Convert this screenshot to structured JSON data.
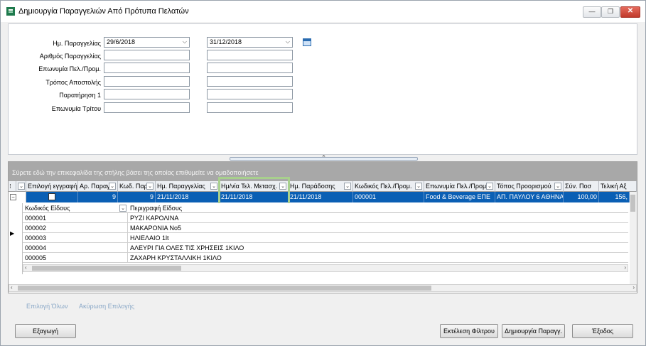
{
  "window": {
    "title": "Δημιουργία Παραγγελιών Από Πρότυπα Πελατών",
    "min_glyph": "—",
    "max_glyph": "❐",
    "close_glyph": "✕"
  },
  "filters": {
    "order_date_label": "Ημ. Παραγγελίας",
    "order_date_from": "29/6/2018",
    "order_date_to": "31/12/2018",
    "order_no_label": "Αριθμός Παραγγελίας",
    "customer_label": "Επωνυμία Πελ./Προμ.",
    "shipping_label": "Τρόπος Αποστολής",
    "note1_label": "Παρατήρηση 1",
    "third_party_label": "Επωνυμία Τρίτου"
  },
  "grid": {
    "group_hint": "Σύρετε εδώ την επικεφαλίδα της στήλης βάσει της οποίας επιθυμείτε να ομαδοποιήσετε",
    "columns": [
      "Επιλογή εγγραφής",
      "Αρ. Παραγ",
      "Κωδ. Παρ",
      "Ημ. Παραγγελίας",
      "Ημ/νία Τελ. Μετασχ.",
      "Ημ. Παράδοσης",
      "Κωδικός Πελ./Προμ.",
      "Επωνυμία Πελ./Προμ.",
      "Τόπος Προορισμού",
      "Σύν. Ποσ",
      "Τελική Αξ"
    ],
    "selected_row": {
      "order_no": "9",
      "code": "9",
      "order_date": "21/11/2018",
      "final_transform_date": "21/11/2018",
      "delivery_date": "21/11/2018",
      "customer_code": "000001",
      "customer_name": "Food & Beverage ΕΠΕ",
      "destination": "ΑΠ. ΠΑΥΛΟΥ 6 ΑΘΗΝΑ",
      "total_qty": "100,00",
      "final_value": "156,"
    },
    "child": {
      "col_code": "Κωδικός Είδους",
      "col_desc": "Περιγραφή Είδους",
      "rows": [
        {
          "code": "000001",
          "desc": "ΡΥΖΙ ΚΑΡΟΛΙΝΑ"
        },
        {
          "code": "000002",
          "desc": "ΜΑΚΑΡΟΝΙΑ No5"
        },
        {
          "code": "000003",
          "desc": "ΗΛΙΕΛΑΙΟ 1lt"
        },
        {
          "code": "000004",
          "desc": "ΑΛΕΥΡΙ ΓΙΑ ΟΛΕΣ ΤΙΣ ΧΡΗΣΕΙΣ 1ΚΙΛΟ"
        },
        {
          "code": "000005",
          "desc": "ΖΑΧΑΡΗ ΚΡΥΣΤΑΛΛΙΚΗ 1ΚΙΛΟ"
        }
      ]
    }
  },
  "actions": {
    "select_all": "Επιλογή Όλων",
    "cancel_selection": "Ακύρωση Επιλογής",
    "export": "Εξαγωγή",
    "run_filter": "Εκτέλεση Φίλτρου",
    "create_orders": "Δημιουργία Παραγγ.",
    "exit": "Έξοδος"
  },
  "colors": {
    "selected_row": "#0a5fb4",
    "highlight_box": "#a8d08d",
    "group_bar": "#a8a8a8"
  }
}
